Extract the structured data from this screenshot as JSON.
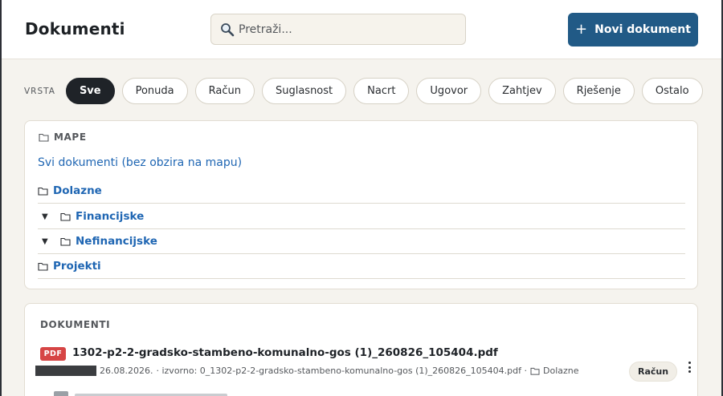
{
  "header": {
    "title": "Dokumenti",
    "search_placeholder": "Pretraži...",
    "new_button_label": "Novi dokument"
  },
  "filters": {
    "label": "VRSTA",
    "chips": [
      "Sve",
      "Ponuda",
      "Račun",
      "Suglasnost",
      "Nacrt",
      "Ugovor",
      "Zahtjev",
      "Rješenje",
      "Ostalo"
    ],
    "active": "Sve"
  },
  "folders": {
    "heading": "MAPE",
    "all_link": "Svi dokumenti (bez obzira na mapu)",
    "items": [
      {
        "name": "Dolazne"
      },
      {
        "name": "Financijske"
      },
      {
        "name": "Nefinancijske"
      },
      {
        "name": "Projekti"
      }
    ]
  },
  "documents": {
    "heading": "DOKUMENTI",
    "items": [
      {
        "file_type": "PDF",
        "title": "1302-p2-2-gradsko-stambeno-komunalno-gos (1)_260826_105404.pdf",
        "date": "26.08.2026.",
        "source": "· izvorno: 0_1302-p2-2-gradsko-stambeno-komunalno-gos (1)_260826_105404.pdf ·",
        "folder": "Dolazne",
        "doc_type": "Račun"
      }
    ]
  },
  "colors": {
    "primary": "#215a86",
    "link": "#1f66b3",
    "pdf_badge": "#d64545",
    "background": "#f5f3ee"
  }
}
